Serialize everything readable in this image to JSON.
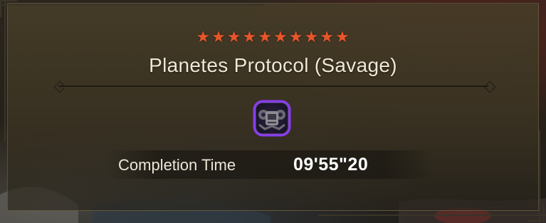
{
  "quest": {
    "difficulty_stars": 10,
    "star_glyph": "★",
    "star_color": "#e8552b",
    "title": "Planetes Protocol (Savage)",
    "emblem_icon": "monster-emblem-icon",
    "emblem_color": "#8a3cf0"
  },
  "completion": {
    "label": "Completion Time",
    "value": "09'55\"20"
  }
}
